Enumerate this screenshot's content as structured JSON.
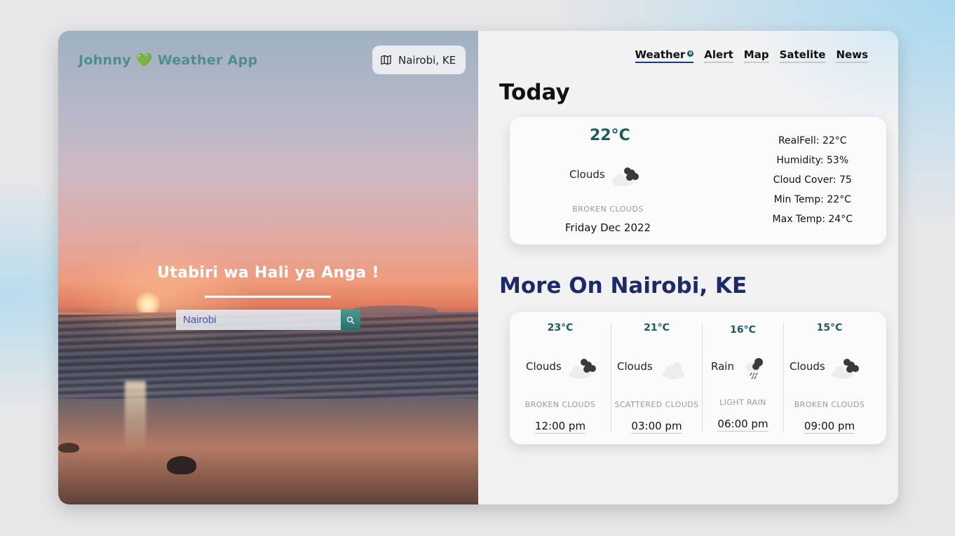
{
  "brand": {
    "name_left": "Johnny",
    "heart": "💚",
    "name_right": "Weather App"
  },
  "location_pill": {
    "icon": "map-icon",
    "label": "Nairobi, KE"
  },
  "hero": {
    "tagline": "Utabiri wa Hali ya Anga !"
  },
  "search": {
    "value": "Nairobi",
    "icon": "search-icon"
  },
  "nav": [
    {
      "label": "Weather",
      "active": true,
      "badge": "0"
    },
    {
      "label": "Alert"
    },
    {
      "label": "Map"
    },
    {
      "label": "Satelite"
    },
    {
      "label": "News"
    }
  ],
  "today": {
    "title": "Today",
    "temp": "22°C",
    "condition": "Clouds",
    "icon": "broken-clouds-icon",
    "description": "BROKEN CLOUDS",
    "date": "Friday Dec 2022",
    "stats": [
      "RealFell: 22°C",
      "Humidity: 53%",
      "Cloud Cover: 75",
      "Min Temp: 22°C",
      "Max Temp: 24°C"
    ]
  },
  "more": {
    "title": "More On Nairobi, KE",
    "slots": [
      {
        "temp": "23°C",
        "condition": "Clouds",
        "icon": "broken-clouds-icon",
        "description": "BROKEN CLOUDS",
        "time": "12:00 pm"
      },
      {
        "temp": "21°C",
        "condition": "Clouds",
        "icon": "scattered-clouds-icon",
        "description": "SCATTERED CLOUDS",
        "time": "03:00 pm"
      },
      {
        "temp": "16°C",
        "condition": "Rain",
        "icon": "light-rain-icon",
        "description": "LIGHT RAIN",
        "time": "06:00 pm"
      },
      {
        "temp": "15°C",
        "condition": "Clouds",
        "icon": "broken-clouds-icon",
        "description": "BROKEN CLOUDS",
        "time": "09:00 pm"
      }
    ]
  },
  "colors": {
    "accent": "#1a5c5f",
    "title_blue": "#1c2a6b",
    "nav_active": "#1d3a8a"
  }
}
